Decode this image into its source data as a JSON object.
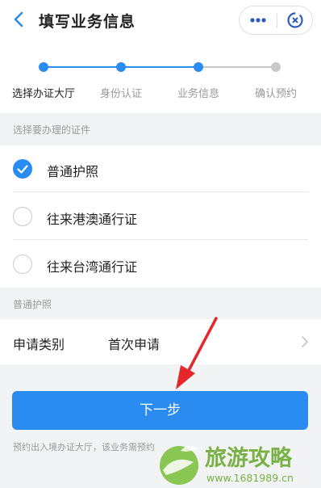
{
  "header": {
    "title": "填写业务信息"
  },
  "steps": {
    "items": [
      {
        "label": "选择办证大厅",
        "state": "done"
      },
      {
        "label": "身份认证",
        "state": "done"
      },
      {
        "label": "业务信息",
        "state": "current"
      },
      {
        "label": "确认预约",
        "state": "todo"
      }
    ]
  },
  "certificate_section": {
    "label": "选择要办理的证件",
    "options": [
      {
        "label": "普通护照",
        "selected": true
      },
      {
        "label": "往来港澳通行证",
        "selected": false
      },
      {
        "label": "往来台湾通行证",
        "selected": false
      }
    ]
  },
  "passport_section": {
    "label": "普通护照",
    "apply_type_key": "申请类别",
    "apply_type_value": "首次申请"
  },
  "next_button": {
    "label": "下一步"
  },
  "note": "预约出入境办证大厅，该业务需预约",
  "watermark": {
    "title": "旅游攻略",
    "url": "www.1681989.cn"
  },
  "colors": {
    "primary": "#2a8cf0",
    "inactive": "#c8c8c8",
    "arrow": "#e5262a"
  }
}
